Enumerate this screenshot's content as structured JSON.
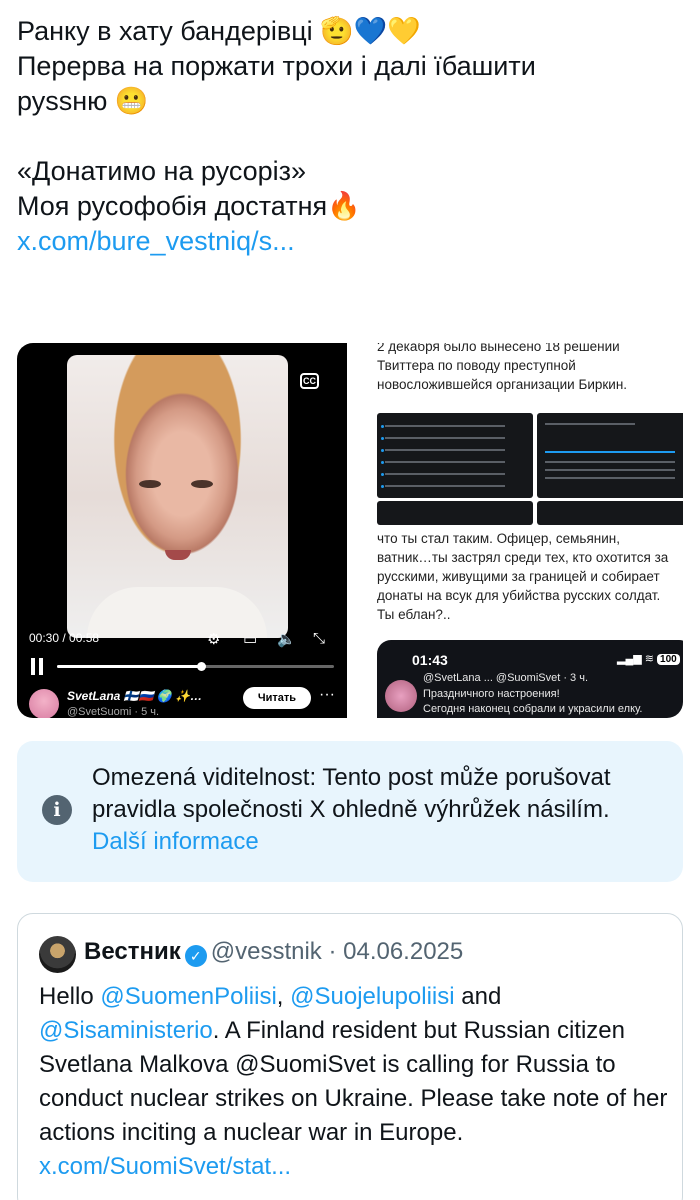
{
  "post": {
    "line1": "Ранку в хату бандерівці",
    "line1_emoji": "🫡💙💛",
    "line2": "Перерва на поржати трохи і далі їбашити",
    "line3": "руssню",
    "line3_emoji": "😬",
    "line4": "«Донатимо на русоріз»",
    "line5": "Моя русофобія достатня",
    "line5_emoji": "🔥",
    "link": "x.com/bure_vestniq/s..."
  },
  "video": {
    "cc": "CC",
    "time": "00:30 / 00:58",
    "progress": 0.52,
    "author_name": "SvetLana 🇫🇮🇷🇺 🌍 ✨…",
    "author_handle": "@SvetSuomi · 5 ч.",
    "read_button": "Читать",
    "more": "···",
    "icons": [
      "gear-icon",
      "airplay-icon",
      "volume-icon",
      "fullscreen-icon"
    ]
  },
  "panel_top": {
    "line1": "2 декабря было вынесено 18 решений",
    "line2": "Твиттера по поводу преступной",
    "line3": "новосложившейся организации Биркин."
  },
  "panel_bottom": {
    "line1": "что ты стал таким. Офицер, семьянин,",
    "line2": "ватник…ты застрял среди тех, кто охотится за",
    "line3": "русскими, живущими  за границей и собирает",
    "line4": "донаты на всук для убийства русских солдат.",
    "line5": "Ты еблан?..",
    "phone_time": "01:43",
    "phone_battery": "100",
    "phone_line1": "@SvetLana ... @SuomiSvet · 3 ч.",
    "phone_line2": "Праздничного настроения!",
    "phone_line3": "Сегодня наконец собрали и украсили елку."
  },
  "notice": {
    "text": "Omezená viditelnost: Tento post může porušovat pravidla společnosti X ohledně výhrůžek násilím.",
    "link": "Další informace"
  },
  "quote": {
    "name": "Вестник",
    "handle": "@vesstnik",
    "date": "04.06.2025",
    "hello": "Hello ",
    "mention1": "@SuomenPoliisi",
    "comma": ", ",
    "mention2": "@Suojelupoliisi",
    "and": " and",
    "mention3": "@Sisaministerio",
    "body": ". A Finland resident but Russian citizen Svetlana Malkova @SuomiSvet is calling for Russia to conduct nuclear strikes on Ukraine. Please take note of her actions inciting a nuclear war in Europe. ",
    "link": "x.com/SuomiSvet/stat..."
  }
}
